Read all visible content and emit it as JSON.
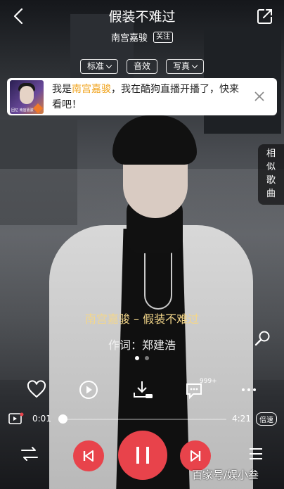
{
  "header": {
    "song_title": "假装不难过",
    "artist": "南宫嘉骏",
    "follow_label": "关注"
  },
  "options": [
    {
      "label": "标准",
      "has_caret": true
    },
    {
      "label": "音效",
      "has_caret": false
    },
    {
      "label": "写真",
      "has_caret": true
    }
  ],
  "banner": {
    "text_prefix": "我是",
    "highlight": "南宫嘉骏",
    "text_suffix": "，我在酷狗直播开播了，快来看吧！",
    "thumb_label": "回忆 南宫嘉骏"
  },
  "similar_songs_label": [
    "相",
    "似",
    "歌",
    "曲"
  ],
  "lyrics": {
    "line1": "南宫嘉骏 – 假装不难过",
    "line2": "作词：郑建浩"
  },
  "actions": {
    "comment_count": "999+"
  },
  "progress": {
    "current": "0:01",
    "total": "4:21",
    "speed_label": "倍速"
  },
  "watermark": "百家号/娱小叁",
  "colors": {
    "accent_red": "#e8434b",
    "highlight_orange": "#f0a31c",
    "lyric_gold": "#f4d78a"
  }
}
